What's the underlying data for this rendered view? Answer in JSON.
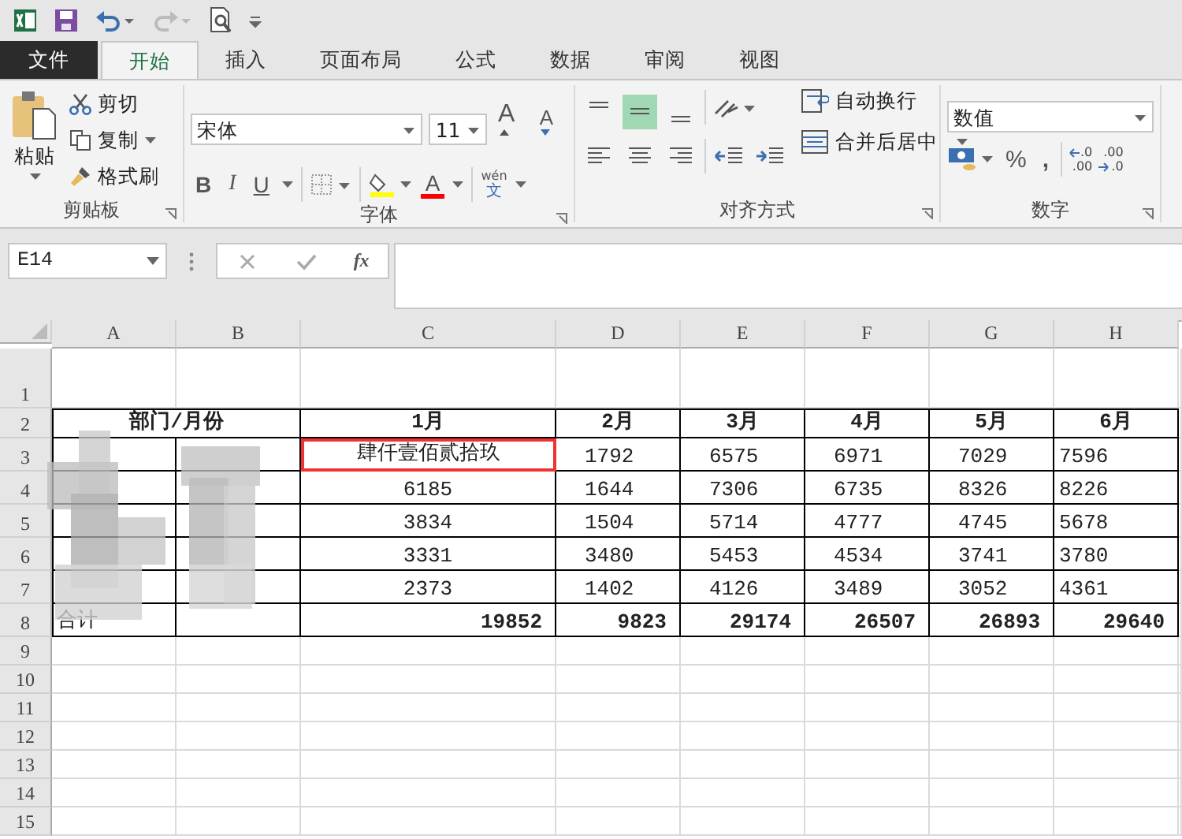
{
  "tabs": [
    {
      "label": "文件",
      "kind": "file",
      "selected": false
    },
    {
      "label": "开始",
      "kind": "tab",
      "selected": true
    },
    {
      "label": "插入",
      "kind": "tab",
      "selected": false
    },
    {
      "label": "页面布局",
      "kind": "tab",
      "selected": false
    },
    {
      "label": "公式",
      "kind": "tab",
      "selected": false
    },
    {
      "label": "数据",
      "kind": "tab",
      "selected": false
    },
    {
      "label": "审阅",
      "kind": "tab",
      "selected": false
    },
    {
      "label": "视图",
      "kind": "tab",
      "selected": false
    }
  ],
  "ribbon": {
    "clipboard": {
      "paste": "粘贴",
      "cut": "剪切",
      "copy": "复制",
      "format_painter": "格式刷",
      "label": "剪贴板"
    },
    "font": {
      "name": "宋体",
      "size": "11",
      "grow": "A",
      "shrink": "A",
      "bold": "B",
      "italic": "I",
      "underline": "U",
      "font_color_letter": "A",
      "phonetic_top": "wén",
      "phonetic_bottom": "文",
      "label": "字体"
    },
    "alignment": {
      "vertical": [
        {
          "selected": false
        },
        {
          "selected": true
        },
        {
          "selected": false
        }
      ],
      "wrap_text": "自动换行",
      "merge_center": "合并后居中",
      "label": "对齐方式"
    },
    "number": {
      "format": "数值",
      "percent": "%",
      "comma": ",",
      "increase_decimal": [
        ".0",
        ".00"
      ],
      "decrease_decimal": [
        ".00",
        ".0"
      ],
      "label": "数字"
    }
  },
  "formula_bar": {
    "name_box": "E14",
    "fx": "fx"
  },
  "sheet": {
    "columns": [
      "A",
      "B",
      "C",
      "D",
      "E",
      "F",
      "G",
      "H"
    ],
    "rows": [
      {
        "number": "1",
        "kind": "blank"
      },
      {
        "number": "2",
        "kind": "header",
        "cells": [
          {
            "text": "部门/月份",
            "merged": true
          },
          {
            "text": "1月"
          },
          {
            "text": "2月"
          },
          {
            "text": "3月"
          },
          {
            "text": "4月"
          },
          {
            "text": "5月"
          },
          {
            "text": "6月"
          }
        ]
      },
      {
        "number": "3",
        "kind": "data",
        "cells": [
          {},
          {},
          {
            "text": "肆仟壹佰贰拾玖",
            "highlighted": true
          },
          {
            "text": "1792",
            "highlighted": false
          },
          {
            "text": "6575",
            "highlighted": false
          },
          {
            "text": "6971",
            "highlighted": false
          },
          {
            "text": "7029",
            "highlighted": false
          },
          {
            "text": "7596",
            "highlighted": false
          }
        ]
      },
      {
        "number": "4",
        "kind": "data",
        "cells": [
          {},
          {},
          {
            "text": "6185",
            "highlighted": false
          },
          {
            "text": "1644",
            "highlighted": false
          },
          {
            "text": "7306",
            "highlighted": false
          },
          {
            "text": "6735",
            "highlighted": false
          },
          {
            "text": "8326",
            "highlighted": false
          },
          {
            "text": "8226",
            "highlighted": false
          }
        ]
      },
      {
        "number": "5",
        "kind": "data",
        "cells": [
          {},
          {},
          {
            "text": "3834",
            "highlighted": false
          },
          {
            "text": "1504",
            "highlighted": false
          },
          {
            "text": "5714",
            "highlighted": false
          },
          {
            "text": "4777",
            "highlighted": false
          },
          {
            "text": "4745",
            "highlighted": false
          },
          {
            "text": "5678",
            "highlighted": false
          }
        ]
      },
      {
        "number": "6",
        "kind": "data",
        "cells": [
          {},
          {},
          {
            "text": "3331",
            "highlighted": false
          },
          {
            "text": "3480",
            "highlighted": false
          },
          {
            "text": "5453",
            "highlighted": false
          },
          {
            "text": "4534",
            "highlighted": false
          },
          {
            "text": "3741",
            "highlighted": false
          },
          {
            "text": "3780",
            "highlighted": false
          }
        ]
      },
      {
        "number": "7",
        "kind": "data",
        "cells": [
          {},
          {},
          {
            "text": "2373",
            "highlighted": false
          },
          {
            "text": "1402",
            "highlighted": false
          },
          {
            "text": "4126",
            "highlighted": false
          },
          {
            "text": "3489",
            "highlighted": false
          },
          {
            "text": "3052",
            "highlighted": false
          },
          {
            "text": "4361",
            "highlighted": false
          }
        ]
      },
      {
        "number": "8",
        "kind": "total",
        "cells": [
          {
            "text": "合计"
          },
          {},
          {
            "text": "19852"
          },
          {
            "text": "9823"
          },
          {
            "text": "29174"
          },
          {
            "text": "26507"
          },
          {
            "text": "26893"
          },
          {
            "text": "29640"
          }
        ]
      },
      {
        "number": "9",
        "kind": "blank"
      },
      {
        "number": "10",
        "kind": "blank"
      },
      {
        "number": "11",
        "kind": "blank"
      },
      {
        "number": "12",
        "kind": "blank"
      },
      {
        "number": "13",
        "kind": "blank"
      },
      {
        "number": "14",
        "kind": "blank"
      },
      {
        "number": "15",
        "kind": "blank"
      }
    ],
    "obscured": true
  }
}
